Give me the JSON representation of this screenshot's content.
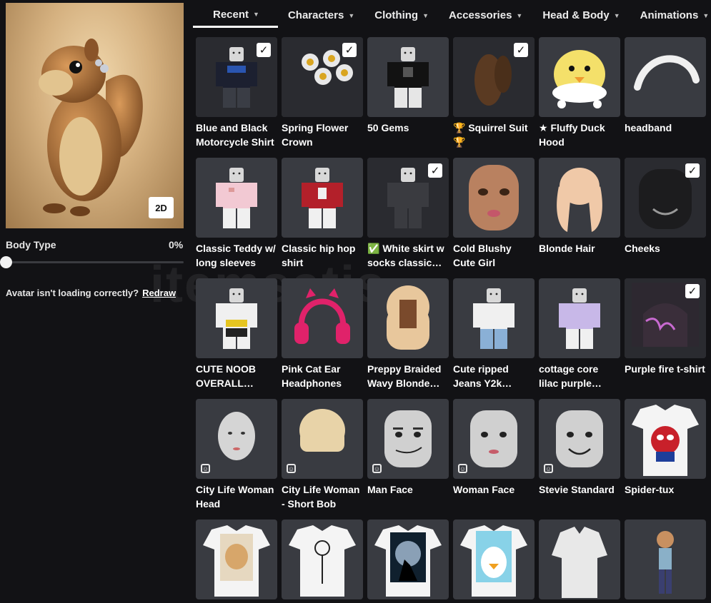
{
  "avatar": {
    "view_toggle": "2D"
  },
  "body_type": {
    "label": "Body Type",
    "value": "0%"
  },
  "status": {
    "message": "Avatar isn't loading correctly?",
    "link": "Redraw"
  },
  "watermark": "itemsatis",
  "tabs": [
    {
      "label": "Recent",
      "active": true
    },
    {
      "label": "Characters"
    },
    {
      "label": "Clothing"
    },
    {
      "label": "Accessories"
    },
    {
      "label": "Head & Body"
    },
    {
      "label": "Animations"
    }
  ],
  "items": [
    {
      "name": "Blue and Black Motorcycle Shirt",
      "thumb": "shirt-dark",
      "checked": true
    },
    {
      "name": "Spring Flower Crown",
      "thumb": "flowers",
      "checked": true
    },
    {
      "name": "50 Gems",
      "thumb": "gems-shirt",
      "checked": false
    },
    {
      "name": "🏆 Squirrel Suit 🏆",
      "thumb": "squirrel",
      "checked": true
    },
    {
      "name": "★ Fluffy Duck Hood",
      "thumb": "duck-hood",
      "checked": false
    },
    {
      "name": "headband",
      "thumb": "headband",
      "checked": false
    },
    {
      "name": "Classic Teddy w/ long sleeves",
      "thumb": "pink-teddy",
      "checked": false
    },
    {
      "name": "Classic hip hop shirt",
      "thumb": "hiphop",
      "checked": false
    },
    {
      "name": "✅ White skirt w socks classic…",
      "thumb": "skirt-dark",
      "checked": true
    },
    {
      "name": "Cold Blushy Cute Girl",
      "thumb": "face-girl",
      "checked": false
    },
    {
      "name": "Blonde Hair",
      "thumb": "blonde-hair",
      "checked": false
    },
    {
      "name": "Cheeks",
      "thumb": "cheeks",
      "checked": true
    },
    {
      "name": "CUTE NOOB OVERALL…",
      "thumb": "overall",
      "checked": false
    },
    {
      "name": "Pink Cat Ear Headphones",
      "thumb": "headphones",
      "checked": false
    },
    {
      "name": "Preppy Braided Wavy Blonde…",
      "thumb": "braided-hair",
      "checked": false
    },
    {
      "name": "Cute ripped Jeans Y2k…",
      "thumb": "jeans",
      "checked": false
    },
    {
      "name": "cottage core lilac purple…",
      "thumb": "lilac",
      "checked": false
    },
    {
      "name": "Purple fire t-shirt",
      "thumb": "purple-fire",
      "checked": true
    },
    {
      "name": "City Life Woman Head",
      "thumb": "head-woman",
      "emote": true
    },
    {
      "name": "City Life Woman - Short Bob",
      "thumb": "bob-hair",
      "emote": true
    },
    {
      "name": "Man Face",
      "thumb": "man-face",
      "emote": true
    },
    {
      "name": "Woman Face",
      "thumb": "woman-face",
      "emote": true
    },
    {
      "name": "Stevie Standard",
      "thumb": "stevie",
      "emote": true
    },
    {
      "name": "Spider-tux",
      "thumb": "spider-tshirt",
      "emote": false
    },
    {
      "name": "",
      "thumb": "tshirt-dog"
    },
    {
      "name": "",
      "thumb": "tshirt-flower"
    },
    {
      "name": "",
      "thumb": "tshirt-wolf"
    },
    {
      "name": "",
      "thumb": "tshirt-penguin"
    },
    {
      "name": "",
      "thumb": "white-shirt"
    },
    {
      "name": "",
      "thumb": "avatar-figure"
    }
  ],
  "colors": {
    "background": "#121215",
    "card": "#393b41",
    "text": "#ffffff"
  }
}
